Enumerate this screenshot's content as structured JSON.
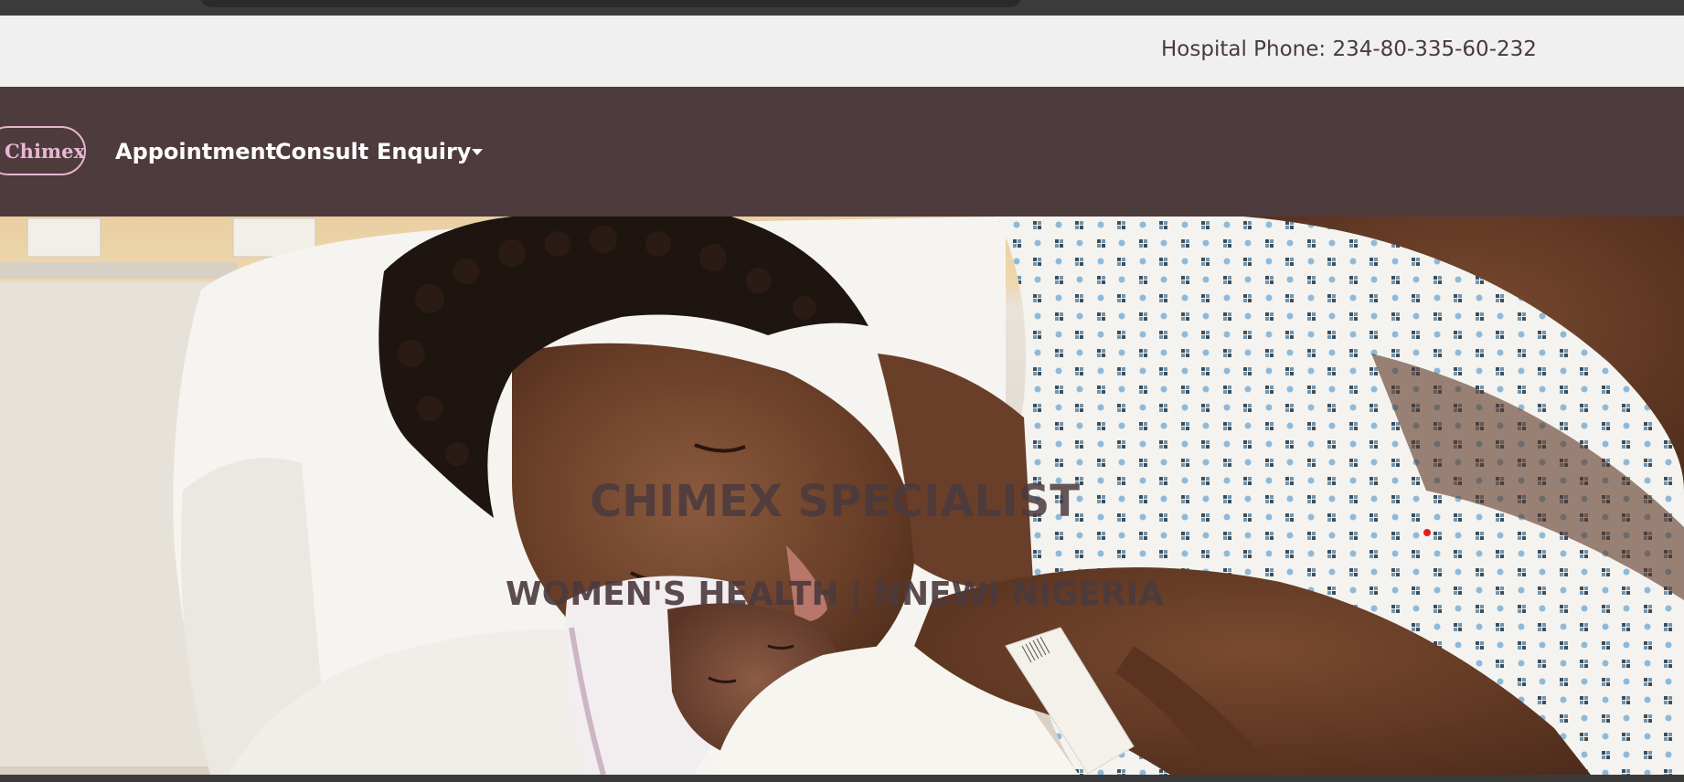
{
  "topbar": {
    "phone_text": "Hospital Phone: 234-80-335-60-232"
  },
  "navbar": {
    "brand": "Chimex",
    "items": [
      {
        "label": "Appointment"
      },
      {
        "label": "Consult"
      },
      {
        "label": "Enquiry"
      }
    ]
  },
  "hero": {
    "title": "CHIMEX SPECIALIST",
    "subtitle": "WOMEN'S HEALTH | NNEWI NIGERIA"
  },
  "colors": {
    "navbar_bg": "#4e3b3e",
    "topbar_bg": "#f0f0f0",
    "brand_pink": "#e9b6d2",
    "text_dark": "#4b3a3e"
  },
  "icons": {
    "dropdown": "caret-down-icon"
  }
}
